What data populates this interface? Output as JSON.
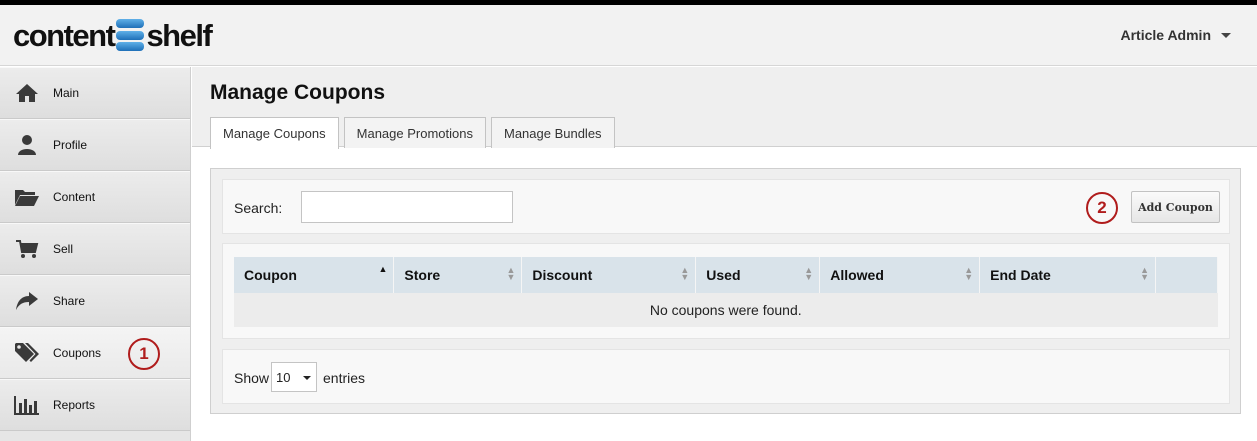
{
  "header": {
    "logo": {
      "left": "content",
      "right": "shelf"
    },
    "user_menu": "Article Admin"
  },
  "sidebar": {
    "items": [
      {
        "label": "Main",
        "icon": "home-icon"
      },
      {
        "label": "Profile",
        "icon": "user-icon"
      },
      {
        "label": "Content",
        "icon": "folder-icon"
      },
      {
        "label": "Sell",
        "icon": "cart-icon"
      },
      {
        "label": "Share",
        "icon": "share-icon"
      },
      {
        "label": "Coupons",
        "icon": "tags-icon",
        "active": true,
        "callout": "1"
      },
      {
        "label": "Reports",
        "icon": "bar-chart-icon"
      }
    ]
  },
  "main": {
    "title": "Manage Coupons",
    "tabs": [
      {
        "label": "Manage Coupons",
        "active": true
      },
      {
        "label": "Manage Promotions"
      },
      {
        "label": "Manage Bundles"
      }
    ],
    "search": {
      "label": "Search:",
      "value": "",
      "placeholder": ""
    },
    "add_button": {
      "label": "Add Coupon",
      "callout": "2"
    },
    "table": {
      "columns": [
        "Coupon",
        "Store",
        "Discount",
        "Used",
        "Allowed",
        "End Date",
        ""
      ],
      "sorted_column": "Coupon",
      "sort_direction": "ascending",
      "empty_message": "No coupons were found."
    },
    "pagination": {
      "show_label": "Show",
      "entries_value": "10",
      "entries_label": "entries"
    }
  },
  "colors": {
    "callout": "#b01c1c",
    "table_header": "#d9e3ea",
    "logo_mark": "#1e6fb8"
  }
}
